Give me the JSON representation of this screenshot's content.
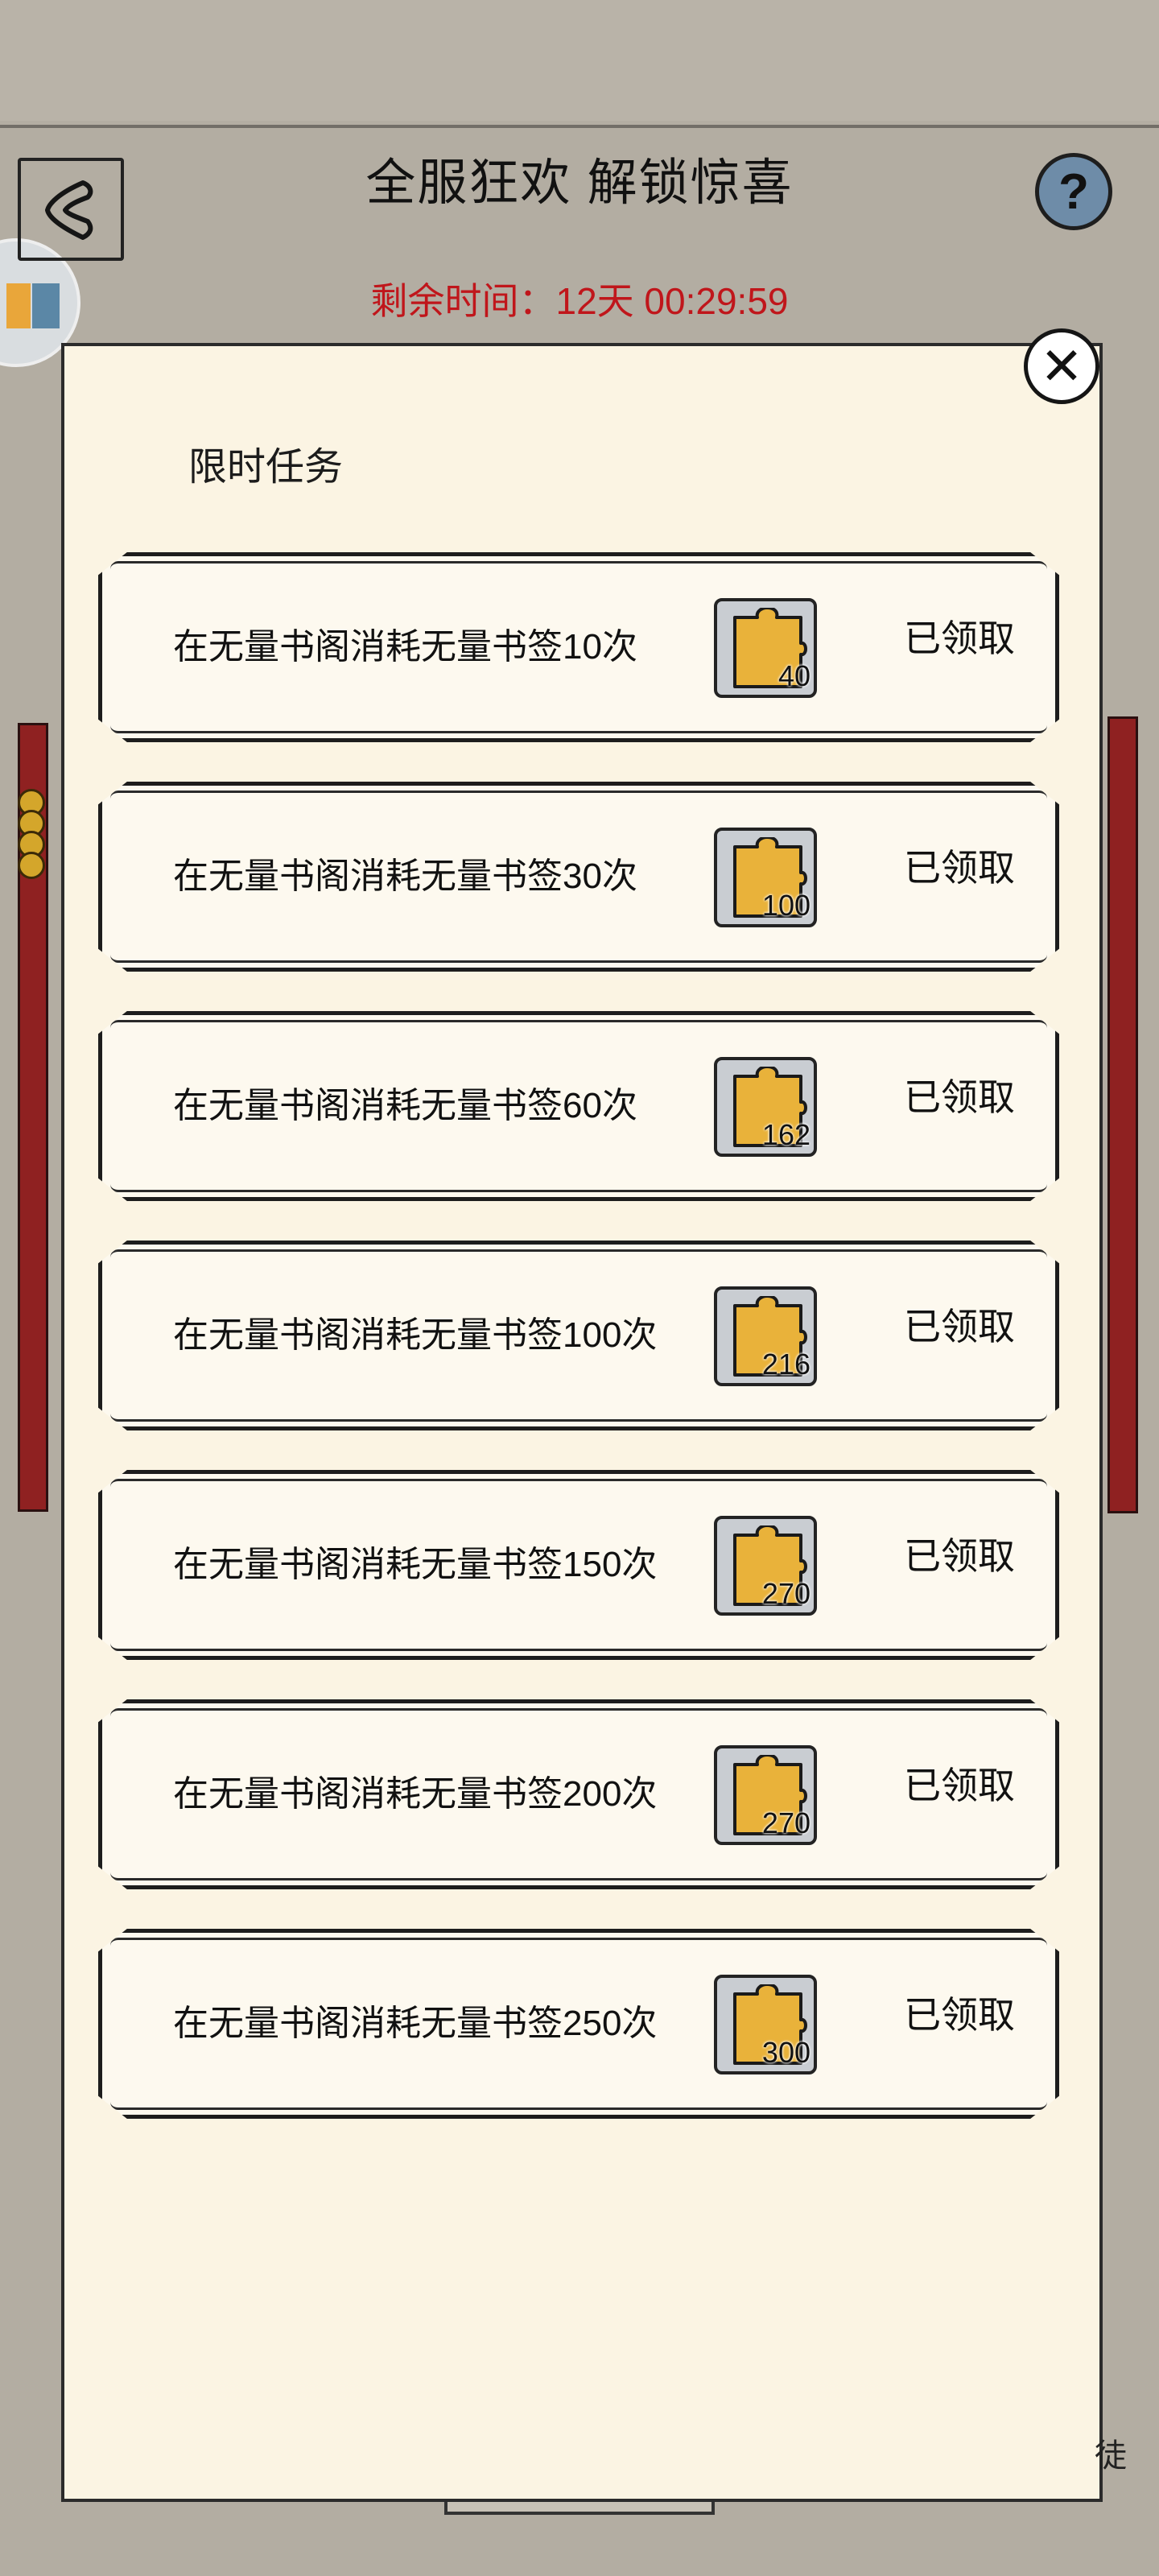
{
  "header": {
    "title": "全服狂欢 解锁惊喜",
    "timer": "剩余时间：12天 00:29:59",
    "help_label": "?"
  },
  "panel": {
    "section_title": "限时任务",
    "close_label": "✕"
  },
  "tasks": [
    {
      "text": "在无量书阁消耗无量书签10次",
      "reward": "40",
      "status": "已领取"
    },
    {
      "text": "在无量书阁消耗无量书签30次",
      "reward": "100",
      "status": "已领取"
    },
    {
      "text": "在无量书阁消耗无量书签60次",
      "reward": "162",
      "status": "已领取"
    },
    {
      "text": "在无量书阁消耗无量书签100次",
      "reward": "216",
      "status": "已领取"
    },
    {
      "text": "在无量书阁消耗无量书签150次",
      "reward": "270",
      "status": "已领取"
    },
    {
      "text": "在无量书阁消耗无量书签200次",
      "reward": "270",
      "status": "已领取"
    },
    {
      "text": "在无量书阁消耗无量书签250次",
      "reward": "300",
      "status": "已领取"
    }
  ],
  "icons": {
    "reward_icon": "puzzle-piece-icon",
    "accent_gold": "#e9b23a",
    "timer_color": "#c0161b"
  },
  "background_text": {
    "edge_char": "徒"
  }
}
